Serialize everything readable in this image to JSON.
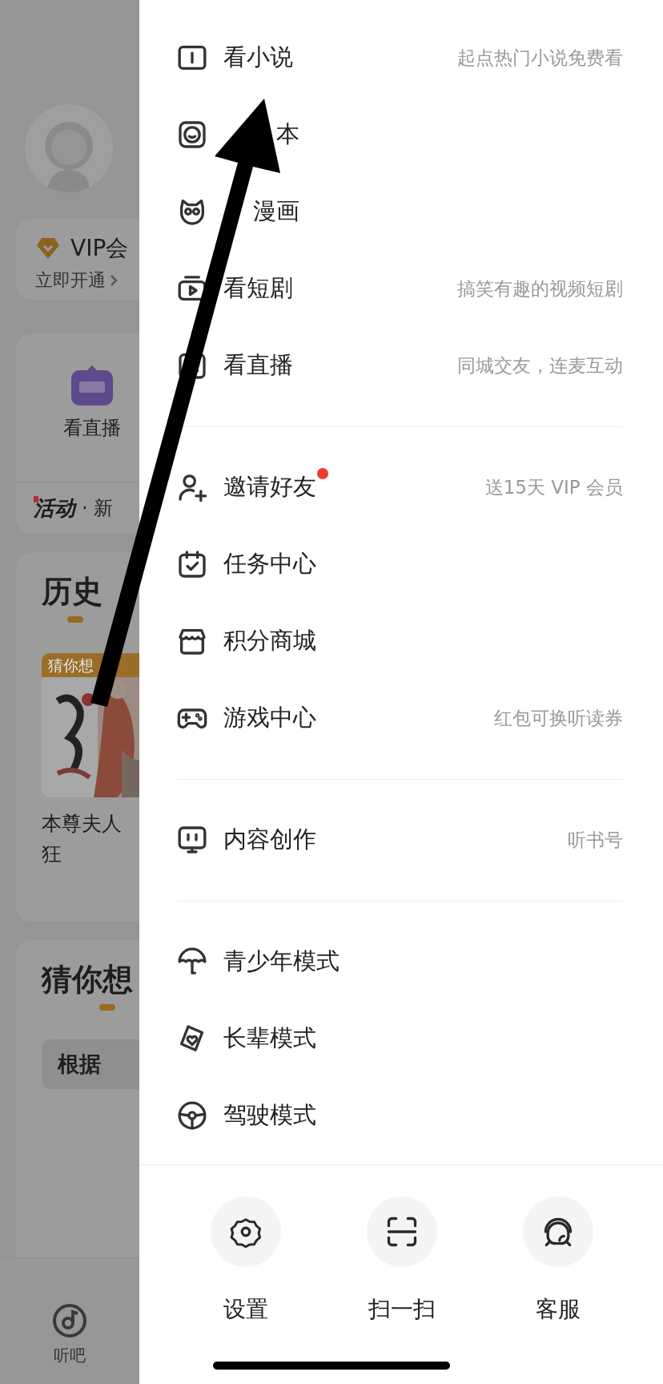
{
  "background": {
    "vip": {
      "title": "VIP会",
      "action": "立即开通"
    },
    "shortcut": {
      "label": "看直播"
    },
    "activity": {
      "tag": "活动",
      "text": "· 新"
    },
    "history": {
      "title": "历史",
      "badge": "猜你想",
      "caption": "本尊夫人",
      "caption_2": "狂"
    },
    "guess": {
      "title": "猜你想",
      "chip": "根据"
    },
    "tab": {
      "label": "听吧"
    }
  },
  "menu_sections": [
    {
      "items": [
        {
          "label": "看小说",
          "note": "起点热门小说免费看"
        },
        {
          "label": "本",
          "kind": "covered"
        },
        {
          "label": "漫画",
          "kind": "covered"
        },
        {
          "label": "看短剧",
          "note": "搞笑有趣的视频短剧"
        },
        {
          "label": "看直播",
          "note": "同城交友，连麦互动"
        }
      ]
    },
    {
      "items": [
        {
          "label": "邀请好友",
          "note": "送15天 VIP 会员",
          "dot": true
        },
        {
          "label": "任务中心"
        },
        {
          "label": "积分商城"
        },
        {
          "label": "游戏中心",
          "note": "红包可换听读券"
        }
      ]
    },
    {
      "items": [
        {
          "label": "内容创作",
          "note": "听书号"
        }
      ]
    },
    {
      "items": [
        {
          "label": "青少年模式"
        },
        {
          "label": "长辈模式"
        },
        {
          "label": "驾驶模式"
        }
      ]
    }
  ],
  "actions": [
    {
      "label": "设置"
    },
    {
      "label": "扫一扫"
    },
    {
      "label": "客服"
    }
  ]
}
